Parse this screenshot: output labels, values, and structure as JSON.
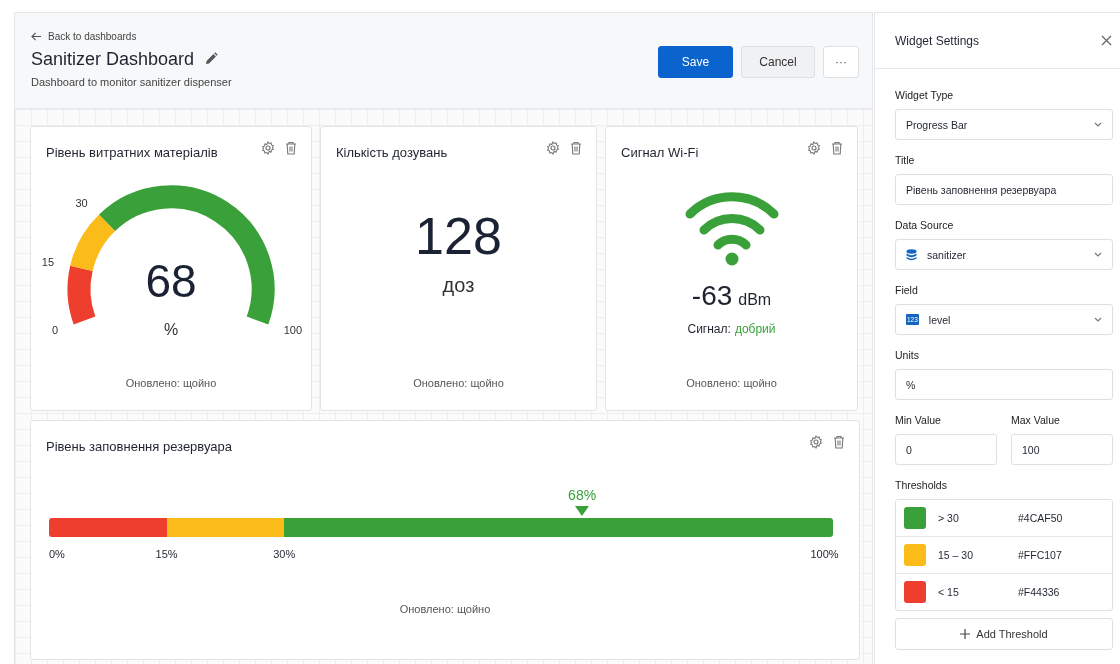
{
  "back_link": "Back to dashboards",
  "title": "Sanitizer Dashboard",
  "description": "Dashboard to monitor sanitizer dispenser",
  "actions": [
    {
      "label": "Save",
      "kind": "primary"
    },
    {
      "label": "Cancel",
      "kind": "secondary"
    },
    {
      "label": "···",
      "kind": "more"
    }
  ],
  "widgets": [
    {
      "kind": "gauge",
      "title": "Рівень витратних матеріалів",
      "value": "68",
      "unit": "%",
      "ticks": [
        "0",
        "15",
        "30",
        "100"
      ],
      "segments": [
        {
          "color": "#ee3e2e"
        },
        {
          "color": "#fbbc1a"
        },
        {
          "color": "#3aa13a"
        }
      ],
      "footer": "Оновлено: щойно"
    },
    {
      "kind": "stat",
      "title": "Кількість дозувань",
      "value": "128",
      "unit": "доз",
      "footer": "Оновлено: щойно"
    },
    {
      "kind": "wifi",
      "title": "Сигнал Wi-Fi",
      "value": "-63",
      "unit": "dBm",
      "status_label": "Сигнал:",
      "status": "добрий",
      "footer": "Оновлено: щойно"
    },
    {
      "kind": "progress",
      "title": "Рівень заповнення резервуара",
      "marker": "68%",
      "level": 0.68,
      "ticks": [
        "0%",
        "15%",
        "30%",
        "100%"
      ],
      "segments": [
        {
          "color": "#ee3e2e"
        },
        {
          "color": "#fbbc1a"
        },
        {
          "color": "#3aa13a"
        }
      ],
      "footer": "Оновлено: щойно"
    }
  ],
  "settings": {
    "title": "Widget Settings",
    "fields": [
      {
        "kind": "select",
        "label": "Widget Type",
        "value": "Progress Bar"
      },
      {
        "kind": "input",
        "label": "Title",
        "value": "Рівень заповнення резервуара"
      },
      {
        "kind": "source",
        "label": "Data Source",
        "value": "sanitizer"
      },
      {
        "kind": "field",
        "label": "Field",
        "value": "level",
        "badge": "123"
      },
      {
        "kind": "input",
        "label": "Units",
        "value": "%"
      }
    ],
    "range": [
      {
        "label": "Min Value",
        "value": "0"
      },
      {
        "label": "Max Value",
        "value": "100"
      }
    ],
    "thresholds_label": "Thresholds",
    "thresholds": [
      {
        "range": "> 30",
        "hex": "#4CAF50",
        "color": "#3aa13a"
      },
      {
        "range": "15 – 30",
        "hex": "#FFC107",
        "color": "#fbbc1a"
      },
      {
        "range": "< 15",
        "hex": "#F44336",
        "color": "#ee3e2e"
      }
    ],
    "add_button": "Add Threshold"
  }
}
